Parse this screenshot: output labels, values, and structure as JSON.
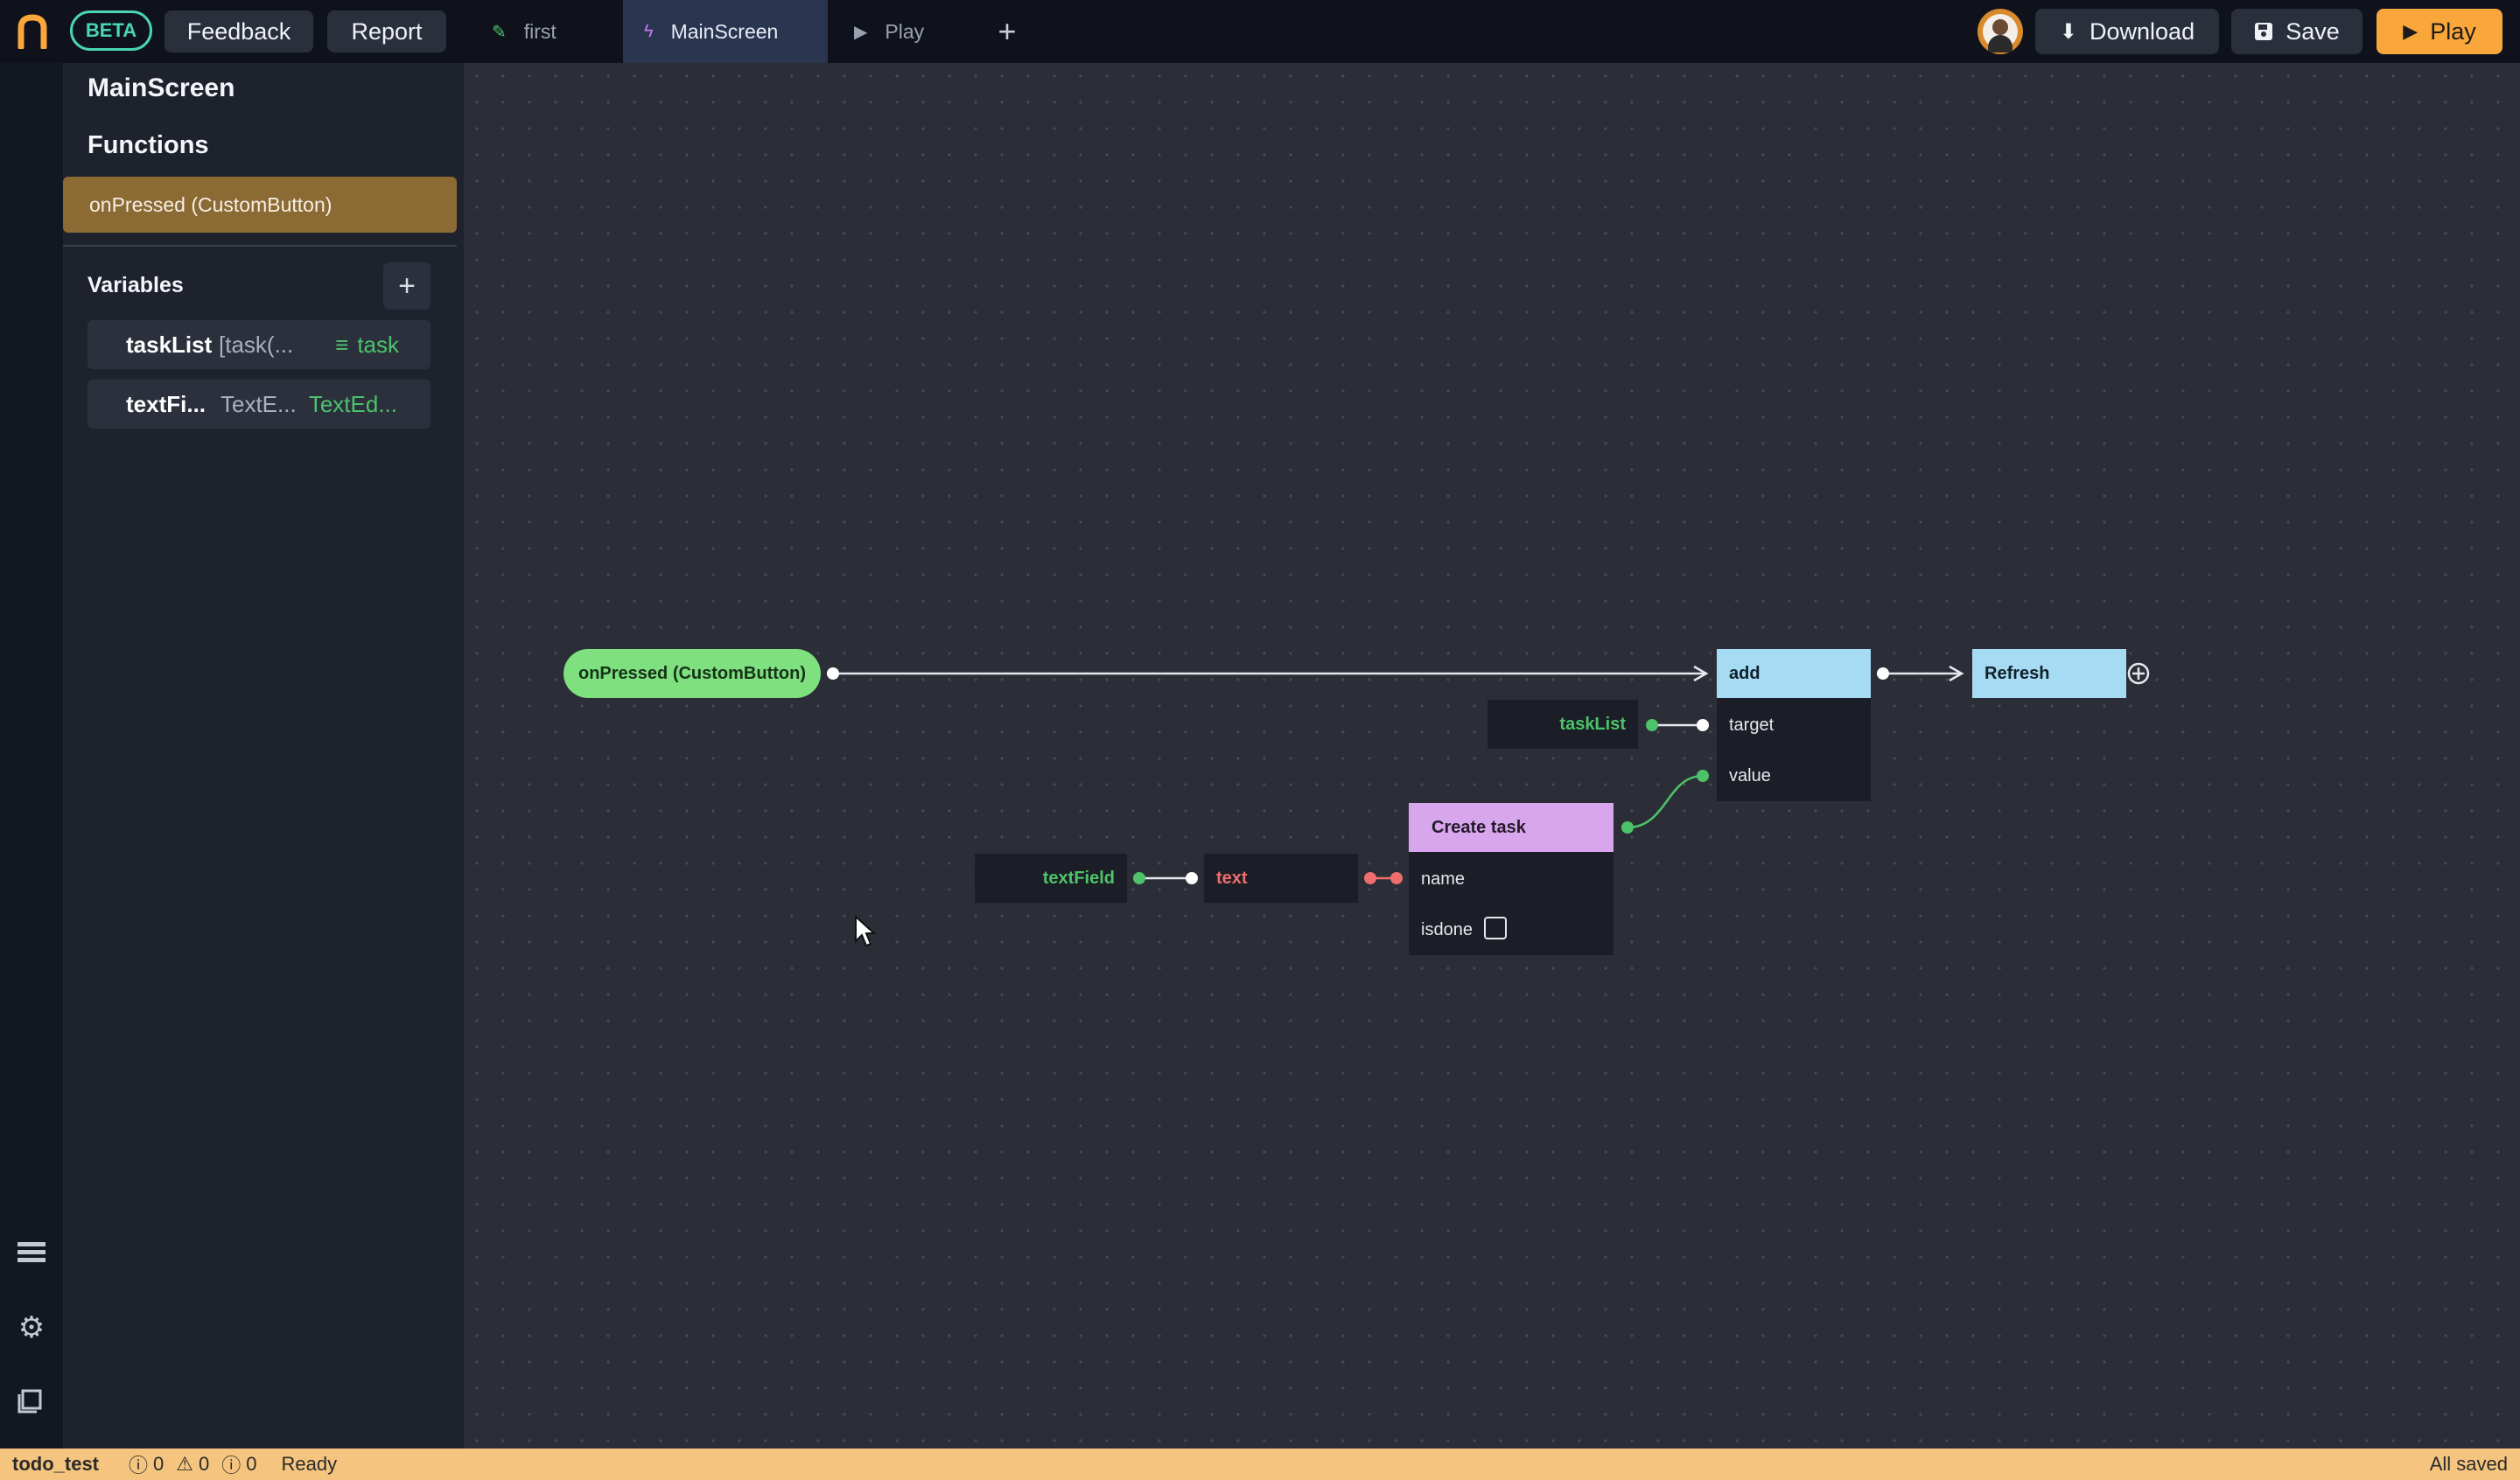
{
  "topbar": {
    "beta": "BETA",
    "feedback": "Feedback",
    "report": "Report",
    "tabs": [
      {
        "label": "first",
        "icon": "pencil-icon"
      },
      {
        "label": "MainScreen",
        "icon": "lightning-icon"
      },
      {
        "label": "Play",
        "icon": "play-icon"
      }
    ],
    "download": "Download",
    "save": "Save",
    "play": "Play"
  },
  "panel": {
    "title": "MainScreen",
    "functions_heading": "Functions",
    "functions": [
      "onPressed (CustomButton)"
    ],
    "variables_heading": "Variables",
    "variables": [
      {
        "name": "taskList",
        "value": "[task(...",
        "type": "task"
      },
      {
        "name": "textFi...",
        "value": "TextE...",
        "type": "TextEd..."
      }
    ]
  },
  "graph": {
    "event": "onPressed (CustomButton)",
    "add": {
      "title": "add",
      "target": "target",
      "value": "value"
    },
    "refresh": "Refresh",
    "tasklist_ref": "taskList",
    "create_task": {
      "title": "Create task",
      "name": "name",
      "isdone": "isdone"
    },
    "textfield_ref": "textField",
    "text_prop": "text"
  },
  "status": {
    "project": "todo_test",
    "errors": "0",
    "warnings": "0",
    "infos": "0",
    "state": "Ready",
    "saved": "All saved"
  },
  "colors": {
    "accent": "#f9a63a",
    "event_node": "#7ee07f",
    "action_node": "#a6dcf3",
    "create_node": "#d8a6ec",
    "function_item": "#8c6a34",
    "status_bar": "#f5c47f",
    "beta_badge": "#48d6b4"
  }
}
